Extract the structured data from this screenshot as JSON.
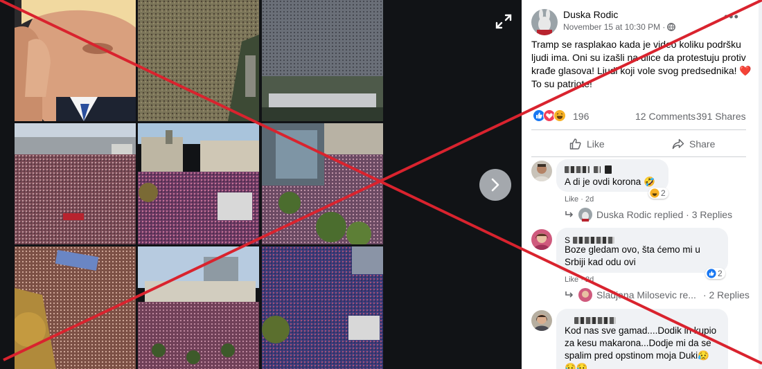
{
  "post": {
    "author": "Duska Rodic",
    "date": "November 15 at 10:30 PM ·",
    "privacy_icon": "globe-icon",
    "text": "Tramp se rasplakao kada je video koliku podršku ljudi ima. Oni su izašli na ulice da protestuju protiv krađe glasova! Ljudi koji vole svog predsednika! ❤️ To su patriote!",
    "more_label": "•••",
    "reactions_count": "196",
    "comments_count": "12 Comments",
    "shares_count": "391 Shares",
    "like_label": "Like",
    "share_label": "Share"
  },
  "comments": [
    {
      "text": "A di je ovdi korona 🤣",
      "reaction_count": "2",
      "actions": "Like · 2d",
      "reply_label": "Duska Rodic replied · 3 Replies"
    },
    {
      "text": "Boze gledam ovo, šta ćemo mi u Srbiji kad odu ovi",
      "reaction_count": "2",
      "actions": "Like · 2d",
      "reply_label": "Sladjana Milosevic re...",
      "reply_count": "· 2 Replies"
    },
    {
      "text": "Kod nas sve gamad....Dodik ih kupio za kesu makarona...Dodje mi da se spalim pred opstinom moja Duki😥",
      "tail": "😥😥"
    }
  ],
  "colors": {
    "photo_bg": "#111316",
    "cross_red": "#d9232e",
    "like_blue": "#1877f2",
    "love_red": "#f33e58"
  }
}
